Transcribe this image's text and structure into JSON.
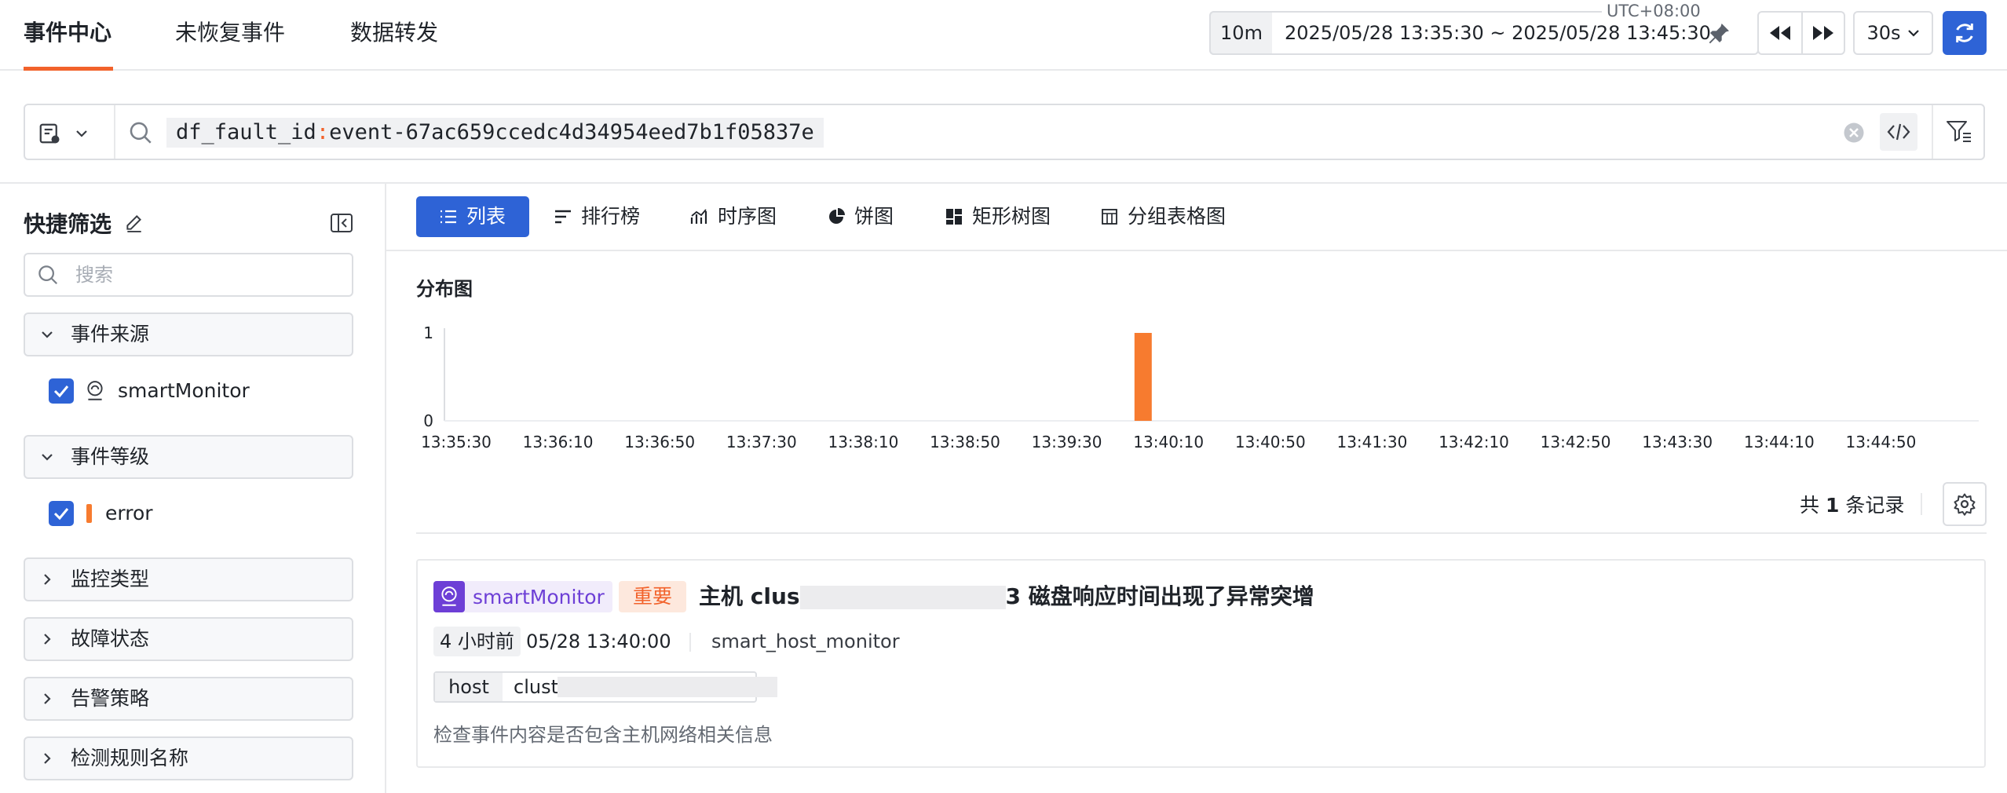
{
  "nav": {
    "tabs": [
      {
        "label": "事件中心",
        "active": true
      },
      {
        "label": "未恢复事件",
        "active": false
      },
      {
        "label": "数据转发",
        "active": false
      }
    ]
  },
  "time": {
    "timezone": "UTC+08:00",
    "preset": "10m",
    "range": "2025/05/28 13:35:30 ~ 2025/05/28 13:45:30",
    "refresh_interval": "30s"
  },
  "search": {
    "key": "df_fault_id",
    "operator": ":",
    "value": "event-67ac659ccedc4d34954eed7b1f05837e"
  },
  "sidebar": {
    "title": "快捷筛选",
    "search_placeholder": "搜索",
    "groups": [
      {
        "label": "事件来源",
        "expanded": true
      },
      {
        "label": "事件等级",
        "expanded": true
      },
      {
        "label": "监控类型",
        "expanded": false
      },
      {
        "label": "故障状态",
        "expanded": false
      },
      {
        "label": "告警策略",
        "expanded": false
      },
      {
        "label": "检测规则名称",
        "expanded": false
      }
    ],
    "source_options": [
      {
        "label": "smartMonitor",
        "checked": true
      }
    ],
    "level_options": [
      {
        "label": "error",
        "checked": true,
        "color": "#f77b2f"
      }
    ]
  },
  "view_tabs": [
    {
      "label": "列表",
      "active": true,
      "icon": "list-icon"
    },
    {
      "label": "排行榜",
      "active": false,
      "icon": "ranking-icon"
    },
    {
      "label": "时序图",
      "active": false,
      "icon": "timeseries-icon"
    },
    {
      "label": "饼图",
      "active": false,
      "icon": "pie-icon"
    },
    {
      "label": "矩形树图",
      "active": false,
      "icon": "treemap-icon"
    },
    {
      "label": "分组表格图",
      "active": false,
      "icon": "grouped-table-icon"
    }
  ],
  "chart_data": {
    "type": "bar",
    "title": "分布图",
    "x_ticks": [
      "13:35:30",
      "13:36:10",
      "13:36:50",
      "13:37:30",
      "13:38:10",
      "13:38:50",
      "13:39:30",
      "13:40:10",
      "13:40:50",
      "13:41:30",
      "13:42:10",
      "13:42:50",
      "13:43:30",
      "13:44:10",
      "13:44:50"
    ],
    "y_ticks": [
      "0",
      "1"
    ],
    "ylim": [
      0,
      1
    ],
    "bars": [
      {
        "x": "13:40:00",
        "value": 1,
        "color": "#f77b2f"
      }
    ],
    "grid": false
  },
  "records": {
    "count_prefix": "共",
    "count": "1",
    "count_suffix": "条记录"
  },
  "event": {
    "source": "smartMonitor",
    "level": "重要",
    "title_prefix": "主机 clus",
    "title_suffix": "3 磁盘响应时间出现了异常突增",
    "relative_time": "4 小时前",
    "time": "05/28 13:40:00",
    "monitor": "smart_host_monitor",
    "tag_key": "host",
    "tag_value": "clust",
    "description": "检查事件内容是否包含主机网络相关信息"
  },
  "colors": {
    "accent": "#2e63d6",
    "brand_orange": "#f2622b",
    "error": "#f77b2f",
    "source_purple": "#6d3fd6"
  }
}
